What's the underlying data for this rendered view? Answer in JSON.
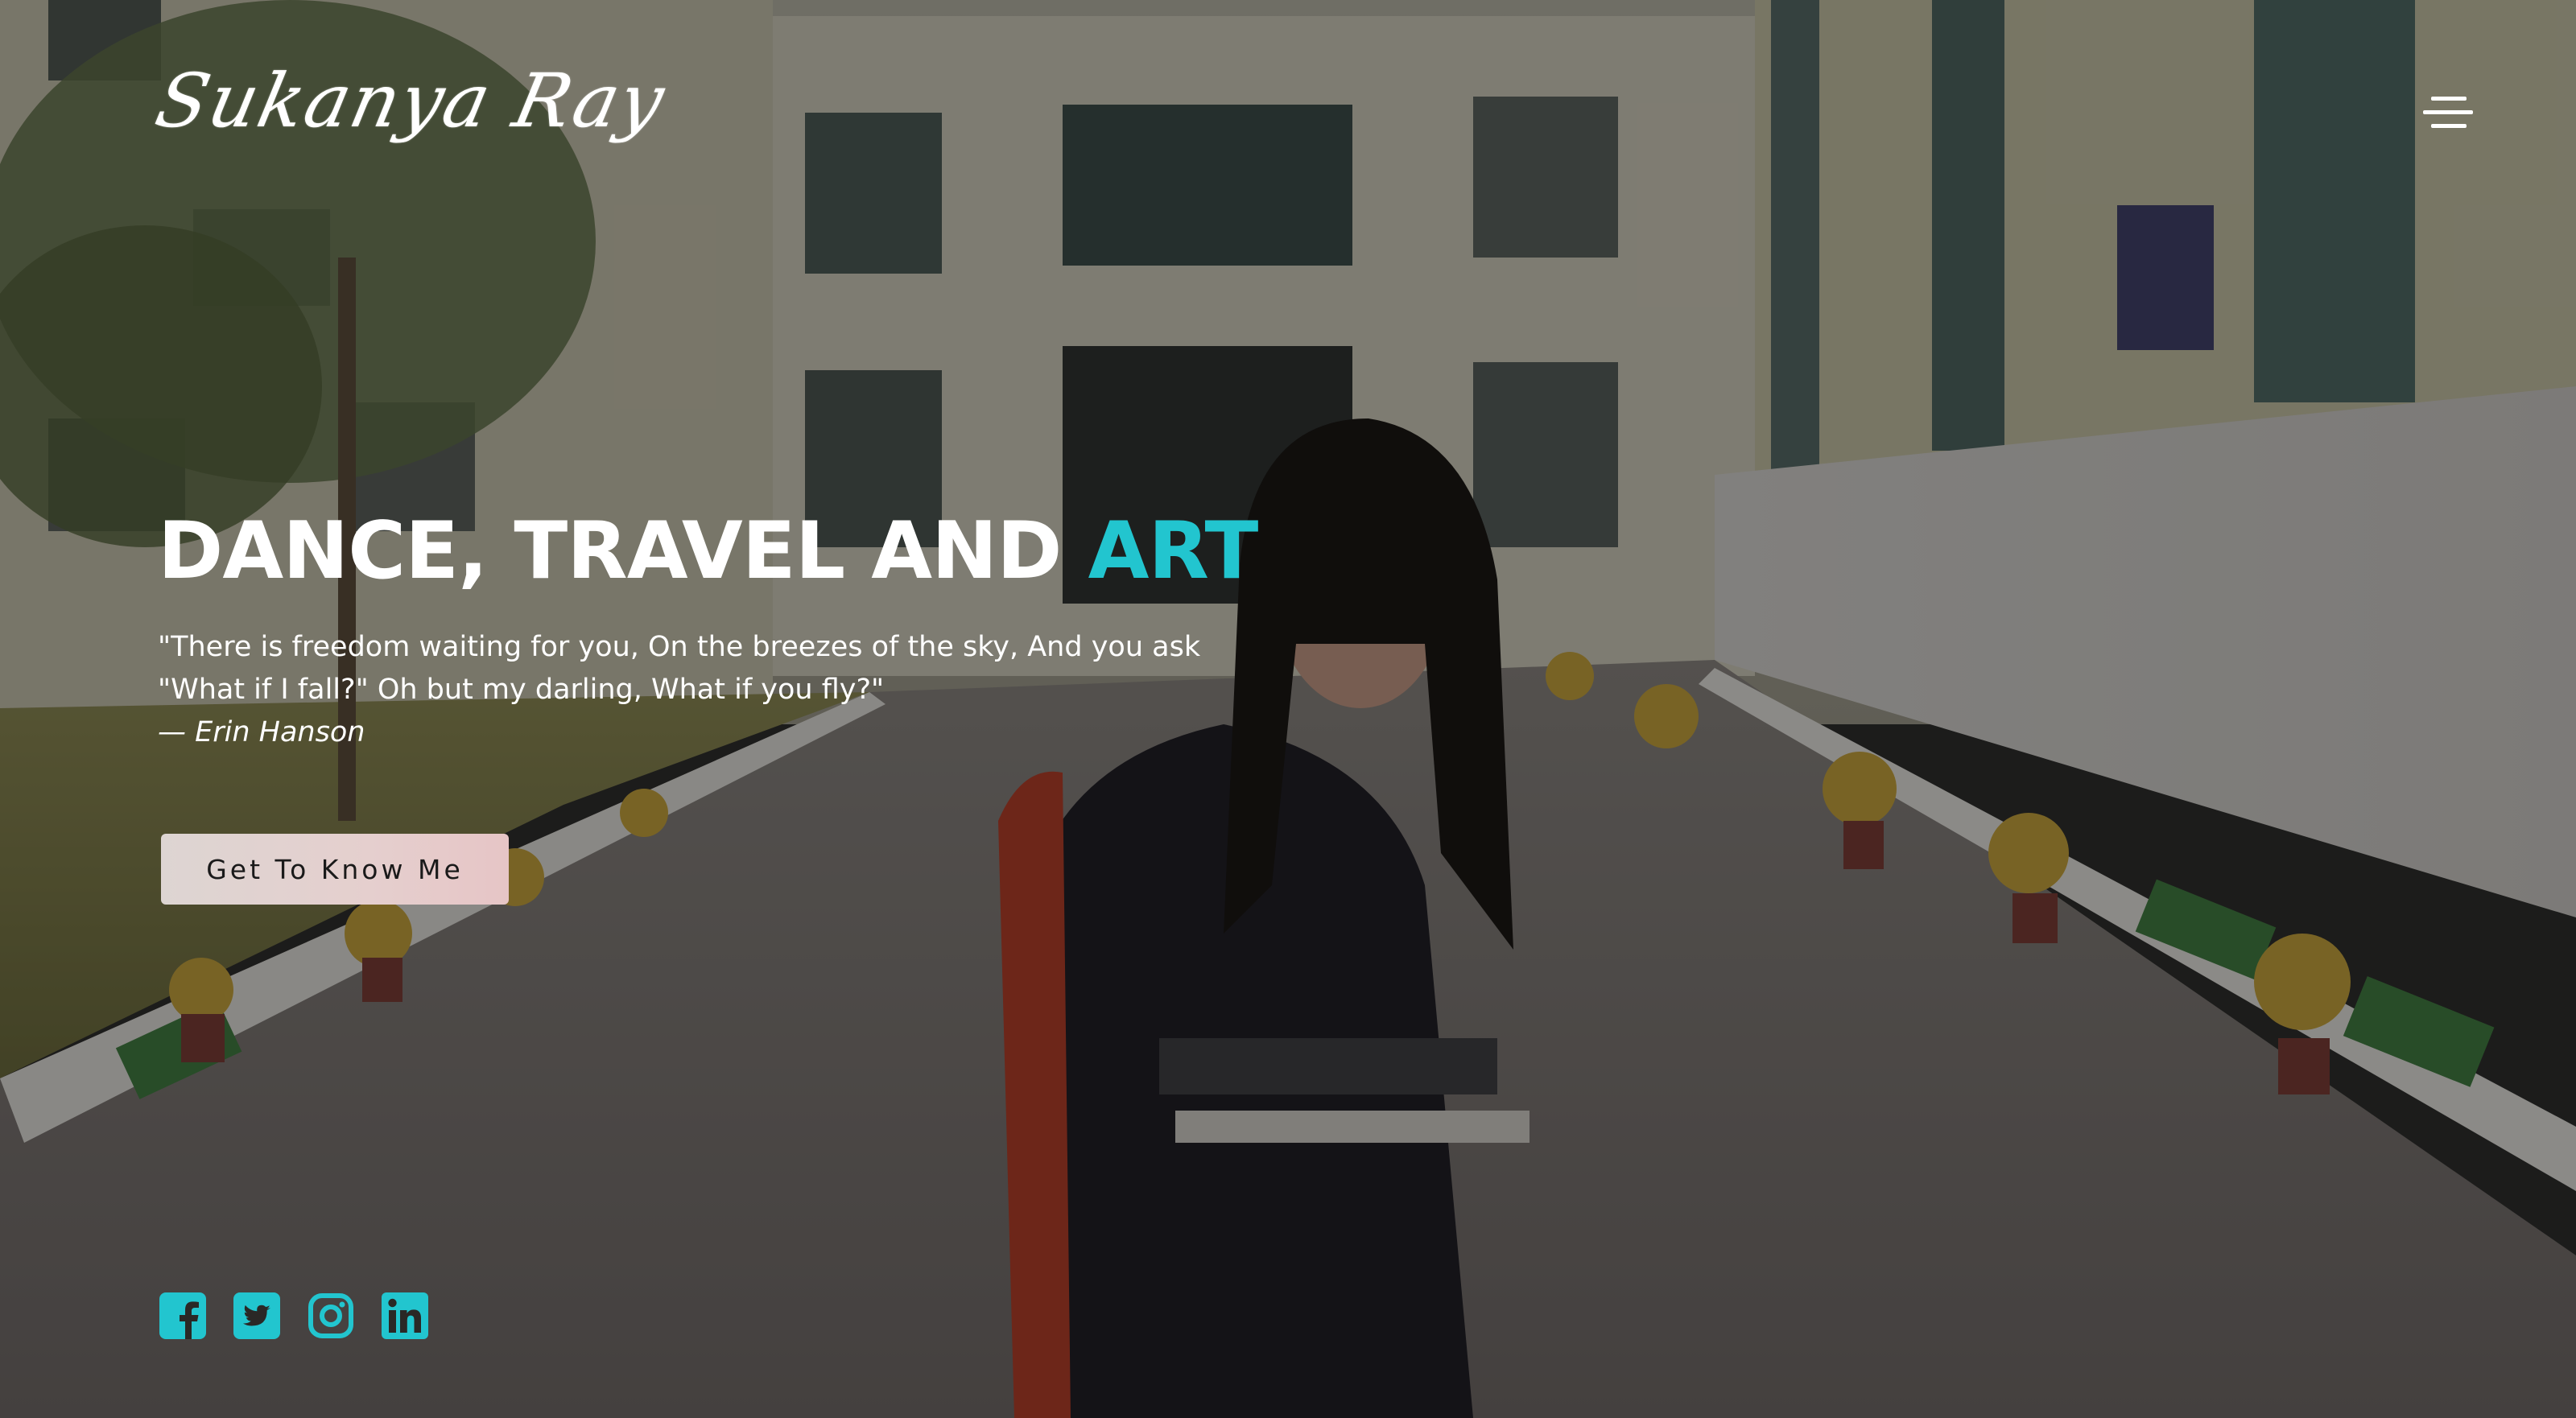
{
  "logo": {
    "text": "Sukanya Ray"
  },
  "header": {
    "menu_icon": "hamburger-menu-icon"
  },
  "hero": {
    "headline_main": "DANCE, TRAVEL AND ",
    "headline_accent": "ART",
    "quote_line_1": "\"There is freedom waiting for you, On the breezes of the sky, And you ask",
    "quote_line_2": "\"What if I fall?\" Oh but my darling, What if you fly?\"",
    "quote_author": "— Erin Hanson",
    "cta_label": "Get To Know Me"
  },
  "social": [
    {
      "name": "facebook",
      "icon": "facebook-icon"
    },
    {
      "name": "twitter",
      "icon": "twitter-icon"
    },
    {
      "name": "instagram",
      "icon": "instagram-icon"
    },
    {
      "name": "linkedin",
      "icon": "linkedin-icon"
    }
  ],
  "colors": {
    "accent": "#22c5cf",
    "text": "#ffffff",
    "button_bg": "#e5cfce",
    "button_text": "#1a1a1a"
  }
}
